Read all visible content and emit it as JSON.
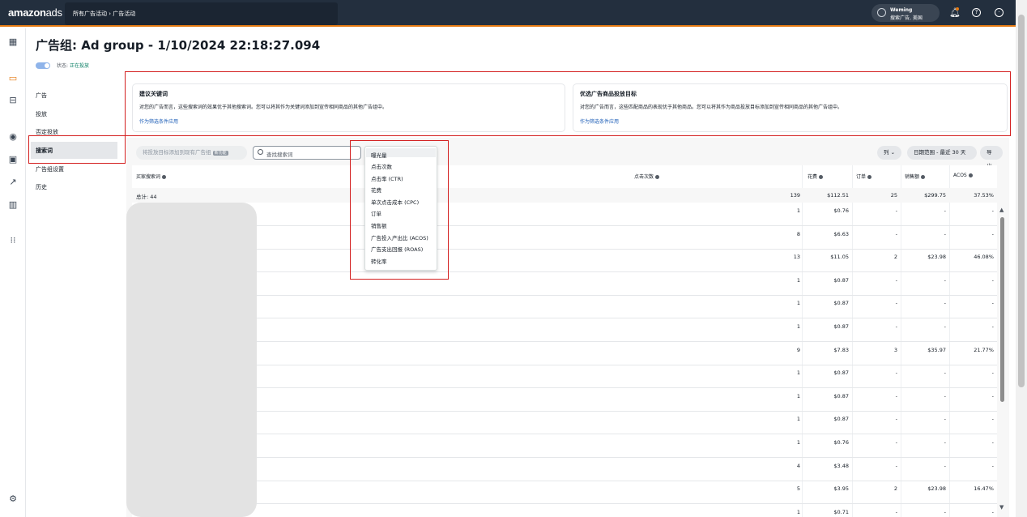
{
  "topbar": {
    "logo_main": "amazon",
    "logo_sub": "ads",
    "breadcrumb": "所有广告活动 › 广告活动",
    "account_name": "Weming",
    "account_sub": "搜索广告, 美国",
    "help_glyph": "?",
    "profile_glyph": "☺",
    "bell_glyph": "🔔"
  },
  "rail": {
    "icons": [
      "grid-icon",
      "campaign-icon",
      "toggle-icon",
      "shield-icon",
      "media-icon",
      "trend-icon",
      "bar-chart-icon",
      "apps-icon",
      "settings-icon"
    ],
    "glyphs": [
      "▦",
      "▭",
      "⊟",
      "◉",
      "▣",
      "↗",
      "▥",
      "⁝⁝",
      "⚙"
    ]
  },
  "page": {
    "title": "广告组: Ad group - 1/10/2024 22:18:27.094",
    "status_label": "状态:",
    "status_value": "正在投放"
  },
  "subnav": [
    "广告",
    "投放",
    "否定投放",
    "搜索词",
    "广告组设置",
    "历史"
  ],
  "cards": [
    {
      "heading": "建议关键词",
      "desc": "对您的广告而言，这些搜索词的效果优于其他搜索词。您可以将其作为关键词添加到宣传相同商品的其他广告组中。",
      "link": "作为筛选条件应用"
    },
    {
      "heading": "优选广告商品投放目标",
      "desc": "对您的广告而言，这些匹配商品的表现优于其他商品。您可以将其作为商品投放目标添加到宣传相同商品的其他广告组中。",
      "link": "作为筛选条件应用"
    }
  ],
  "toolbar": {
    "add_button": "将投放目标添加到现有广告组",
    "add_badge": "新功能",
    "search_placeholder": "查找搜索词",
    "columns_button": "列",
    "date_button": "日期范围 - 最近 30 天",
    "export_button": "导出"
  },
  "dropdown": {
    "items": [
      "曝光量",
      "点击次数",
      "点击率 (CTR)",
      "花费",
      "单次点击成本 (CPC)",
      "订单",
      "销售额",
      "广告投入产出比 (ACOS)",
      "广告支出回报 (ROAS)",
      "转化率"
    ]
  },
  "table": {
    "headers": [
      "买家搜索词",
      "点击次数",
      "花费",
      "订单",
      "销售额",
      "ACOS"
    ],
    "total_label": "总计: 44",
    "totals": [
      "139",
      "$112.51",
      "25",
      "$299.75",
      "37.53%"
    ],
    "rows": [
      [
        "1",
        "$0.76",
        "-",
        "-",
        "-"
      ],
      [
        "8",
        "$6.63",
        "-",
        "-",
        "-"
      ],
      [
        "13",
        "$11.05",
        "2",
        "$23.98",
        "46.08%"
      ],
      [
        "1",
        "$0.87",
        "-",
        "-",
        "-"
      ],
      [
        "1",
        "$0.87",
        "-",
        "-",
        "-"
      ],
      [
        "1",
        "$0.87",
        "-",
        "-",
        "-"
      ],
      [
        "9",
        "$7.83",
        "3",
        "$35.97",
        "21.77%"
      ],
      [
        "1",
        "$0.87",
        "-",
        "-",
        "-"
      ],
      [
        "1",
        "$0.87",
        "-",
        "-",
        "-"
      ],
      [
        "1",
        "$0.87",
        "-",
        "-",
        "-"
      ],
      [
        "1",
        "$0.76",
        "-",
        "-",
        "-"
      ],
      [
        "4",
        "$3.48",
        "-",
        "-",
        "-"
      ],
      [
        "5",
        "$3.95",
        "2",
        "$23.98",
        "16.47%"
      ],
      [
        "1",
        "$0.71",
        "-",
        "-",
        "-"
      ]
    ]
  },
  "colors": {
    "accent": "#e47911",
    "highlight_box": "#d31f1f",
    "link": "#2060b8",
    "navy": "#232f3e"
  }
}
